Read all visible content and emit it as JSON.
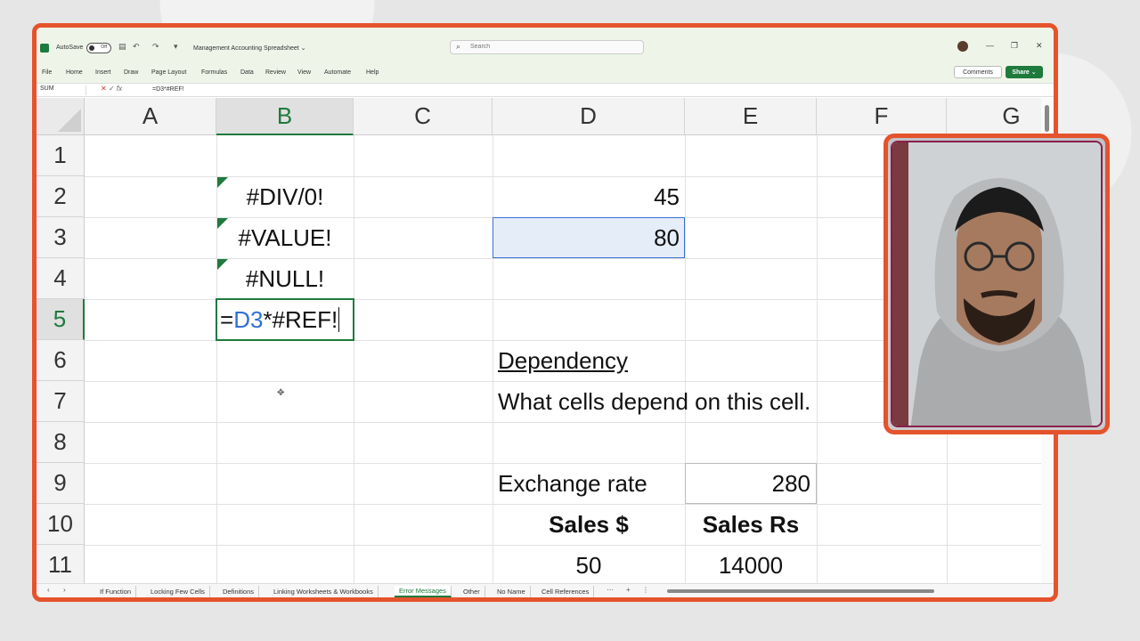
{
  "window": {
    "autosave_label": "AutoSave",
    "autosave_state": "Off",
    "doc_title": "Management Accounting Spreadsheet ⌄",
    "search_placeholder": "Search"
  },
  "ribbon": {
    "menu": [
      "File",
      "Home",
      "Insert",
      "Draw",
      "Page Layout",
      "Formulas",
      "Data",
      "Review",
      "View",
      "Automate",
      "Help"
    ],
    "comments_label": "Comments",
    "share_label": "Share ⌄"
  },
  "formula_bar": {
    "name_box": "SUM",
    "formula": "=D3*#REF!"
  },
  "columns": [
    "A",
    "B",
    "C",
    "D",
    "E",
    "F",
    "G"
  ],
  "rows": [
    "1",
    "2",
    "3",
    "4",
    "5",
    "6",
    "7",
    "8",
    "9",
    "10",
    "11"
  ],
  "cells": {
    "B2": "#DIV/0!",
    "B3": "#VALUE!",
    "B4": "#NULL!",
    "B5_eq": "=",
    "B5_ref": "D3",
    "B5_rest": "*#REF!",
    "D2": "45",
    "D3": "80",
    "D6": "Dependency",
    "D7": "What cells depend on this cell.",
    "D9": "Exchange rate",
    "E9": "280",
    "D10": "Sales $",
    "E10": "Sales Rs",
    "D11": "50",
    "E11": "14000"
  },
  "sheet_tabs": [
    "If Function",
    "Locking Few Cells",
    "Definitions",
    "Linking Worksheets & Workbooks",
    "Error Messages",
    "Other",
    "No Name",
    "Cell References"
  ],
  "active_tab": "Error Messages",
  "colors": {
    "accent": "#1f7a3d",
    "frame": "#e5532c",
    "ref_blue": "#2f6fd6"
  }
}
